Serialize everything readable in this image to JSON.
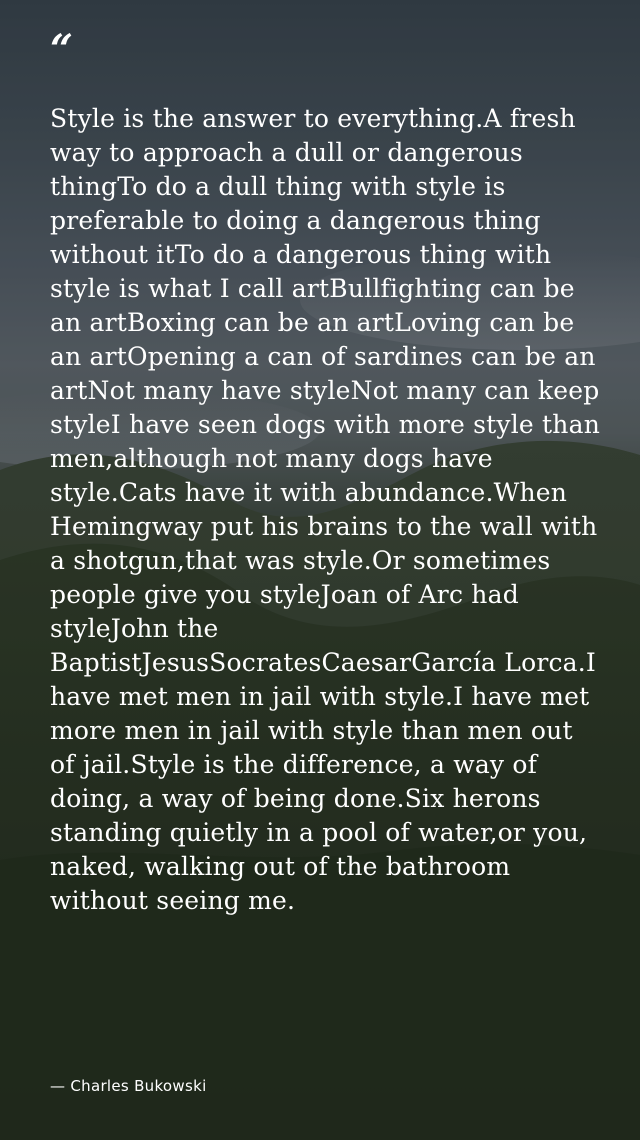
{
  "quote": {
    "mark": "“",
    "text": "Style is the answer to everything.A fresh way to approach a dull or dangerous thingTo do a dull thing with style is preferable to doing a dangerous thing without itTo do a dangerous thing with style is what I call artBullfighting can be an artBoxing can be an artLoving can be an artOpening a can of sardines can be an artNot many have styleNot many can keep styleI have seen dogs with more style than men,although not many dogs have style.Cats have it with abundance.When Hemingway put his brains to the wall with a shotgun,that was style.Or sometimes people give you styleJoan of Arc had styleJohn the BaptistJesusSocratesCaesarGarcía Lorca.I have met men in jail with style.I have met more men in jail with style than men out of jail.Style is the difference, a way of doing, a way of being done.Six herons standing quietly in a pool of water,or you, naked, walking out of the bathroom without seeing me.",
    "author": "— Charles Bukowski"
  },
  "colors": {
    "text": "#ffffff",
    "sky": "#56606a",
    "hills": "#2c3729"
  }
}
